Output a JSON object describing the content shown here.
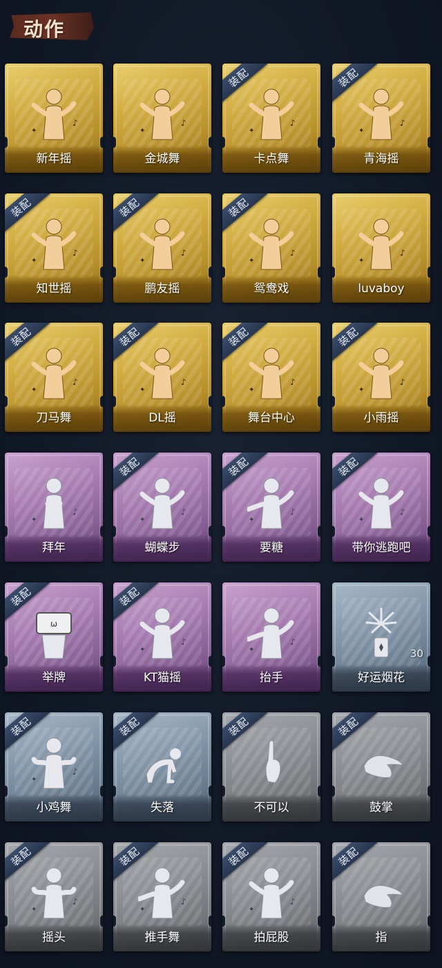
{
  "header": {
    "title": "动作"
  },
  "colors": {
    "gold": "#d2ad42",
    "purple": "#a77cb1",
    "blue": "#8497aa",
    "gray": "#8c8f94",
    "equip_badge": "#2f4160",
    "figure_gold": "#f2cf9a",
    "figure_pale": "#e6e8ee"
  },
  "equip_label": "装配",
  "cards": [
    {
      "name": "新年摇",
      "tier": "gold",
      "equipped": false,
      "icon": "dance-figure-icon"
    },
    {
      "name": "金城舞",
      "tier": "gold",
      "equipped": false,
      "icon": "dance-figure-icon"
    },
    {
      "name": "卡点舞",
      "tier": "gold",
      "equipped": true,
      "icon": "dance-figure-icon"
    },
    {
      "name": "青海摇",
      "tier": "gold",
      "equipped": true,
      "icon": "dance-figure-icon"
    },
    {
      "name": "知世摇",
      "tier": "gold",
      "equipped": true,
      "icon": "dance-figure-icon"
    },
    {
      "name": "鹏友摇",
      "tier": "gold",
      "equipped": true,
      "icon": "dance-figure-icon"
    },
    {
      "name": "鸳鸯戏",
      "tier": "gold",
      "equipped": true,
      "icon": "dance-figure-icon"
    },
    {
      "name": "luvaboy",
      "tier": "gold",
      "equipped": false,
      "icon": "dance-figure-icon"
    },
    {
      "name": "刀马舞",
      "tier": "gold",
      "equipped": true,
      "icon": "dance-figure-icon"
    },
    {
      "name": "DL摇",
      "tier": "gold",
      "equipped": true,
      "icon": "dance-figure-icon"
    },
    {
      "name": "舞台中心",
      "tier": "gold",
      "equipped": true,
      "icon": "dance-figure-icon"
    },
    {
      "name": "小雨摇",
      "tier": "gold",
      "equipped": true,
      "icon": "dance-figure-icon"
    },
    {
      "name": "拜年",
      "tier": "purple",
      "equipped": false,
      "icon": "bow-figure-icon"
    },
    {
      "name": "蝴蝶步",
      "tier": "purple",
      "equipped": true,
      "icon": "dance-figure-icon"
    },
    {
      "name": "要糖",
      "tier": "purple",
      "equipped": true,
      "icon": "reach-figure-icon"
    },
    {
      "name": "带你逃跑吧",
      "tier": "purple",
      "equipped": true,
      "icon": "dance-figure-icon"
    },
    {
      "name": "举牌",
      "tier": "purple",
      "equipped": true,
      "icon": "sign-figure-icon"
    },
    {
      "name": "KT猫摇",
      "tier": "purple",
      "equipped": true,
      "icon": "dance-figure-icon"
    },
    {
      "name": "抬手",
      "tier": "purple",
      "equipped": false,
      "icon": "wave-figure-icon"
    },
    {
      "name": "好运烟花",
      "tier": "blue",
      "equipped": false,
      "icon": "firework-icon",
      "count": "30"
    },
    {
      "name": "小鸡舞",
      "tier": "blue",
      "equipped": true,
      "icon": "chicken-dance-icon"
    },
    {
      "name": "失落",
      "tier": "blue",
      "equipped": true,
      "icon": "crawl-figure-icon"
    },
    {
      "name": "不可以",
      "tier": "gray",
      "equipped": true,
      "icon": "finger-wag-icon"
    },
    {
      "name": "鼓掌",
      "tier": "gray",
      "equipped": true,
      "icon": "clap-hands-icon"
    },
    {
      "name": "摇头",
      "tier": "gray",
      "equipped": true,
      "icon": "shake-figure-icon"
    },
    {
      "name": "推手舞",
      "tier": "gray",
      "equipped": true,
      "icon": "push-figure-icon"
    },
    {
      "name": "拍屁股",
      "tier": "gray",
      "equipped": true,
      "icon": "bend-figure-icon"
    },
    {
      "name": "指",
      "tier": "gray",
      "equipped": true,
      "icon": "pointing-hand-icon"
    }
  ]
}
